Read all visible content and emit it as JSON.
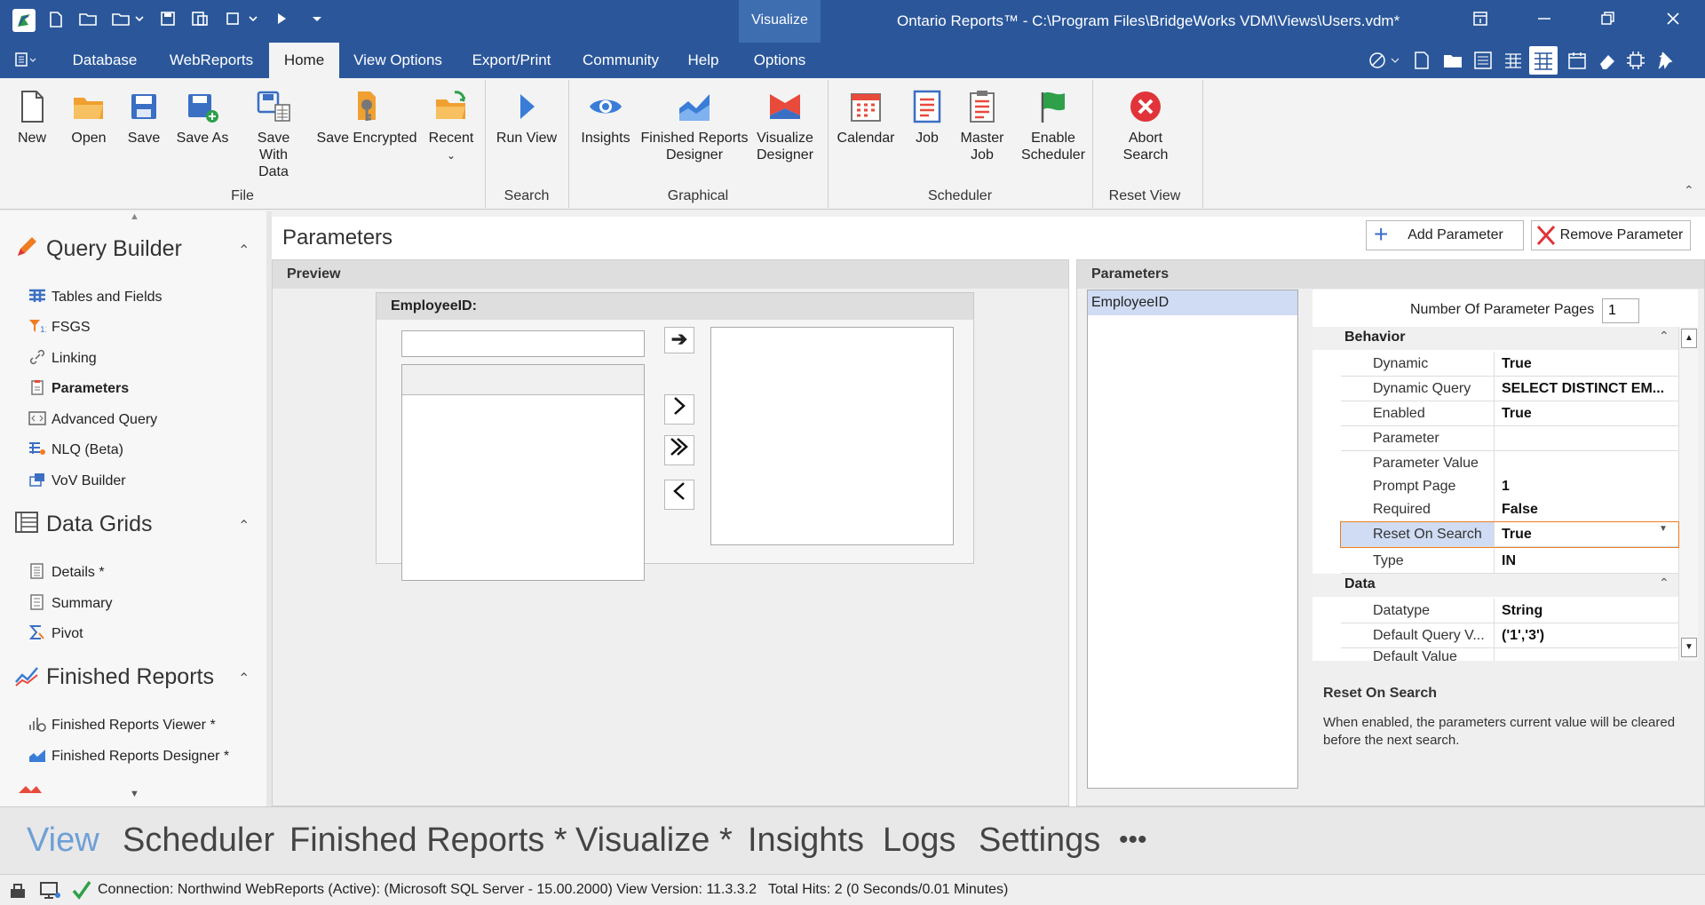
{
  "window": {
    "title": "Ontario Reports™ - C:\\Program Files\\BridgeWorks VDM\\Views\\Users.vdm*",
    "context_tab": "Visualize"
  },
  "ribbon_tabs": [
    "Database",
    "WebReports",
    "Home",
    "View Options",
    "Export/Print",
    "Community",
    "Help",
    "Options"
  ],
  "ribbon": {
    "file": {
      "label": "File",
      "buttons": [
        "New",
        "Open",
        "Save",
        "Save As",
        "Save With Data",
        "Save Encrypted",
        "Recent"
      ]
    },
    "search": {
      "label": "Search",
      "buttons": [
        "Run View"
      ]
    },
    "graphical": {
      "label": "Graphical",
      "buttons": [
        "Insights",
        "Finished Reports Designer",
        "Visualize Designer"
      ]
    },
    "scheduler": {
      "label": "Scheduler",
      "buttons": [
        "Calendar",
        "Job",
        "Master Job",
        "Enable Scheduler"
      ]
    },
    "reset": {
      "label": "Reset View",
      "buttons": [
        "Abort Search"
      ]
    }
  },
  "nav": {
    "query_builder": {
      "title": "Query Builder",
      "items": [
        "Tables and Fields",
        "FSGS",
        "Linking",
        "Parameters",
        "Advanced Query",
        "NLQ (Beta)",
        "VoV Builder"
      ]
    },
    "data_grids": {
      "title": "Data Grids",
      "items": [
        "Details *",
        "Summary",
        "Pivot"
      ]
    },
    "finished_reports": {
      "title": "Finished Reports",
      "items": [
        "Finished Reports Viewer *",
        "Finished Reports Designer *"
      ]
    }
  },
  "main": {
    "title": "Parameters",
    "add_button": "Add Parameter",
    "remove_button": "Remove Parameter",
    "preview_header": "Preview",
    "preview_field_label": "EmployeeID:",
    "params_header": "Parameters",
    "param_list": [
      "EmployeeID"
    ],
    "num_pages_label": "Number Of Parameter Pages",
    "num_pages_value": "1",
    "behavior": {
      "title": "Behavior",
      "rows": [
        {
          "k": "Dynamic",
          "v": "True"
        },
        {
          "k": "Dynamic Query",
          "v": "SELECT DISTINCT EM..."
        },
        {
          "k": "Enabled",
          "v": "True"
        },
        {
          "k": "Parameter",
          "v": ""
        },
        {
          "k": "Parameter Value",
          "v": ""
        },
        {
          "k": "Prompt Page",
          "v": "1"
        },
        {
          "k": "Required",
          "v": "False"
        },
        {
          "k": "Reset On Search",
          "v": "True"
        },
        {
          "k": "Type",
          "v": "IN"
        }
      ]
    },
    "data": {
      "title": "Data",
      "rows": [
        {
          "k": "Datatype",
          "v": "String"
        },
        {
          "k": "Default Query V...",
          "v": "('1','3')"
        },
        {
          "k": "Default Value",
          "v": ""
        }
      ]
    },
    "description_title": "Reset On Search",
    "description_text": "When enabled, the parameters current value will be cleared before the next search."
  },
  "bottom_tabs": [
    "View",
    "Scheduler",
    "Finished Reports *",
    "Visualize *",
    "Insights",
    "Logs",
    "Settings",
    "•••"
  ],
  "status": {
    "text": "Connection: Northwind WebReports (Active): (Microsoft SQL Server - 15.00.2000) View Version: 11.3.3.2   Total Hits: 2 (0 Seconds/0.01 Minutes)"
  },
  "colors": {
    "brand": "#2b579a",
    "highlight": "#f07c22",
    "selected": "#cfdcf3"
  }
}
